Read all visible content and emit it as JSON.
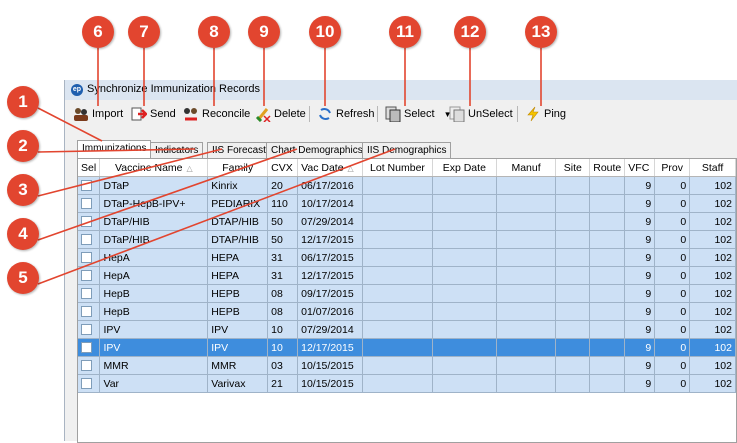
{
  "window": {
    "title": "Synchronize Immunization Records"
  },
  "toolbar": {
    "import_label": "Import",
    "send_label": "Send",
    "reconcile_label": "Reconcile",
    "delete_label": "Delete",
    "refresh_label": "Refresh",
    "select_label": "Select",
    "unselect_label": "UnSelect",
    "ping_label": "Ping"
  },
  "tabs": [
    "Immunizations",
    "Indicators",
    "IIS Forecast",
    "Chart Demographics",
    "IIS Demographics"
  ],
  "active_tab": "Immunizations",
  "grid": {
    "columns": [
      "Sel",
      "Vaccine Name",
      "Family",
      "CVX",
      "Vac Date",
      "Lot Number",
      "Exp Date",
      "Manuf",
      "Site",
      "Route",
      "VFC",
      "Prov",
      "Staff"
    ],
    "rows": [
      {
        "vaccine": "DTaP",
        "family": "Kinrix",
        "cvx": "20",
        "date": "06/17/2016",
        "lot": "",
        "exp": "",
        "manuf": "",
        "site": "",
        "route": "",
        "vfc": "9",
        "prov": "0",
        "staff": "102"
      },
      {
        "vaccine": "DTaP-HepB-IPV+",
        "family": "PEDIARIX",
        "cvx": "110",
        "date": "10/17/2014",
        "lot": "",
        "exp": "",
        "manuf": "",
        "site": "",
        "route": "",
        "vfc": "9",
        "prov": "0",
        "staff": "102"
      },
      {
        "vaccine": "DTaP/HIB",
        "family": "DTAP/HIB",
        "cvx": "50",
        "date": "07/29/2014",
        "lot": "",
        "exp": "",
        "manuf": "",
        "site": "",
        "route": "",
        "vfc": "9",
        "prov": "0",
        "staff": "102"
      },
      {
        "vaccine": "DTaP/HIB",
        "family": "DTAP/HIB",
        "cvx": "50",
        "date": "12/17/2015",
        "lot": "",
        "exp": "",
        "manuf": "",
        "site": "",
        "route": "",
        "vfc": "9",
        "prov": "0",
        "staff": "102"
      },
      {
        "vaccine": "HepA",
        "family": "HEPA",
        "cvx": "31",
        "date": "06/17/2015",
        "lot": "",
        "exp": "",
        "manuf": "",
        "site": "",
        "route": "",
        "vfc": "9",
        "prov": "0",
        "staff": "102"
      },
      {
        "vaccine": "HepA",
        "family": "HEPA",
        "cvx": "31",
        "date": "12/17/2015",
        "lot": "",
        "exp": "",
        "manuf": "",
        "site": "",
        "route": "",
        "vfc": "9",
        "prov": "0",
        "staff": "102"
      },
      {
        "vaccine": "HepB",
        "family": "HEPB",
        "cvx": "08",
        "date": "09/17/2015",
        "lot": "",
        "exp": "",
        "manuf": "",
        "site": "",
        "route": "",
        "vfc": "9",
        "prov": "0",
        "staff": "102"
      },
      {
        "vaccine": "HepB",
        "family": "HEPB",
        "cvx": "08",
        "date": "01/07/2016",
        "lot": "",
        "exp": "",
        "manuf": "",
        "site": "",
        "route": "",
        "vfc": "9",
        "prov": "0",
        "staff": "102"
      },
      {
        "vaccine": "IPV",
        "family": "IPV",
        "cvx": "10",
        "date": "07/29/2014",
        "lot": "",
        "exp": "",
        "manuf": "",
        "site": "",
        "route": "",
        "vfc": "9",
        "prov": "0",
        "staff": "102"
      },
      {
        "vaccine": "IPV",
        "family": "IPV",
        "cvx": "10",
        "date": "12/17/2015",
        "lot": "",
        "exp": "",
        "manuf": "",
        "site": "",
        "route": "",
        "vfc": "9",
        "prov": "0",
        "staff": "102",
        "selected": true
      },
      {
        "vaccine": "MMR",
        "family": "MMR",
        "cvx": "03",
        "date": "10/15/2015",
        "lot": "",
        "exp": "",
        "manuf": "",
        "site": "",
        "route": "",
        "vfc": "9",
        "prov": "0",
        "staff": "102"
      },
      {
        "vaccine": "Var",
        "family": "Varivax",
        "cvx": "21",
        "date": "10/15/2015",
        "lot": "",
        "exp": "",
        "manuf": "",
        "site": "",
        "route": "",
        "vfc": "9",
        "prov": "0",
        "staff": "102"
      }
    ]
  },
  "callouts": [
    "1",
    "2",
    "3",
    "4",
    "5",
    "6",
    "7",
    "8",
    "9",
    "10",
    "11",
    "12",
    "13"
  ],
  "colors": {
    "callout": "#e2452f",
    "row": "#cde0f5",
    "selected_row": "#3e8ddd"
  }
}
